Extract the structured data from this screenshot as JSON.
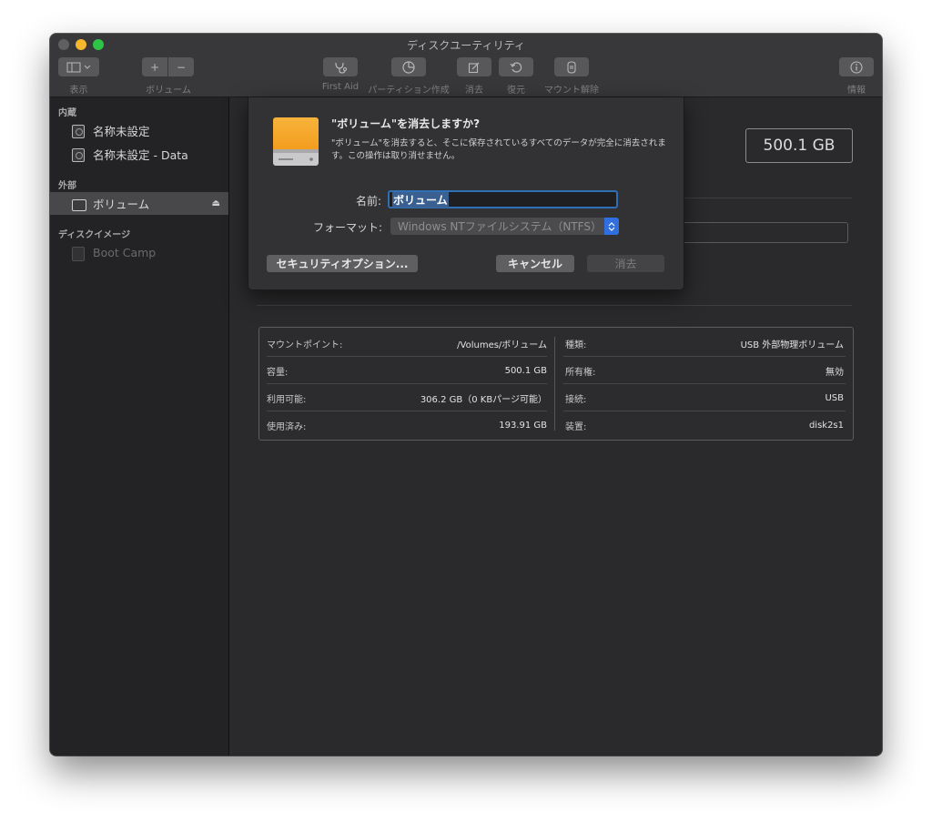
{
  "window": {
    "title": "ディスクユーティリティ"
  },
  "toolbar": {
    "view_label": "表示",
    "volume_label": "ボリューム",
    "firstaid_label": "First Aid",
    "partition_label": "パーティション作成",
    "erase_label": "消去",
    "restore_label": "復元",
    "unmount_label": "マウント解除",
    "info_label": "情報",
    "plus": "+",
    "minus": "−"
  },
  "sidebar": {
    "internal_header": "内蔵",
    "external_header": "外部",
    "images_header": "ディスクイメージ",
    "internal_items": [
      {
        "label": "名称未設定"
      },
      {
        "label": "名称未設定 - Data"
      }
    ],
    "external_items": [
      {
        "label": "ボリューム",
        "eject": "⏏"
      }
    ],
    "image_items": [
      {
        "label": "Boot Camp"
      }
    ]
  },
  "main": {
    "capacity": "500.1 GB",
    "info": {
      "left": [
        {
          "key": "マウントポイント:",
          "value": "/Volumes/ボリューム"
        },
        {
          "key": "容量:",
          "value": "500.1 GB"
        },
        {
          "key": "利用可能:",
          "value": "306.2 GB（0 KBパージ可能）"
        },
        {
          "key": "使用済み:",
          "value": "193.91 GB"
        }
      ],
      "right": [
        {
          "key": "種類:",
          "value": "USB 外部物理ボリューム"
        },
        {
          "key": "所有権:",
          "value": "無効"
        },
        {
          "key": "接続:",
          "value": "USB"
        },
        {
          "key": "装置:",
          "value": "disk2s1"
        }
      ]
    }
  },
  "dialog": {
    "title": "\"ボリューム\"を消去しますか?",
    "message": "\"ボリューム\"を消去すると、そこに保存されているすべてのデータが完全に消去されます。この操作は取り消せません。",
    "name_label": "名前:",
    "name_value": "ボリューム",
    "format_label": "フォーマット:",
    "format_value": "Windows NTファイルシステム（NTFS）",
    "security_button": "セキュリティオプション...",
    "cancel_button": "キャンセル",
    "erase_button": "消去"
  },
  "colors": {
    "accent": "#2f6fe0",
    "drive_orange": "#f5a623"
  }
}
